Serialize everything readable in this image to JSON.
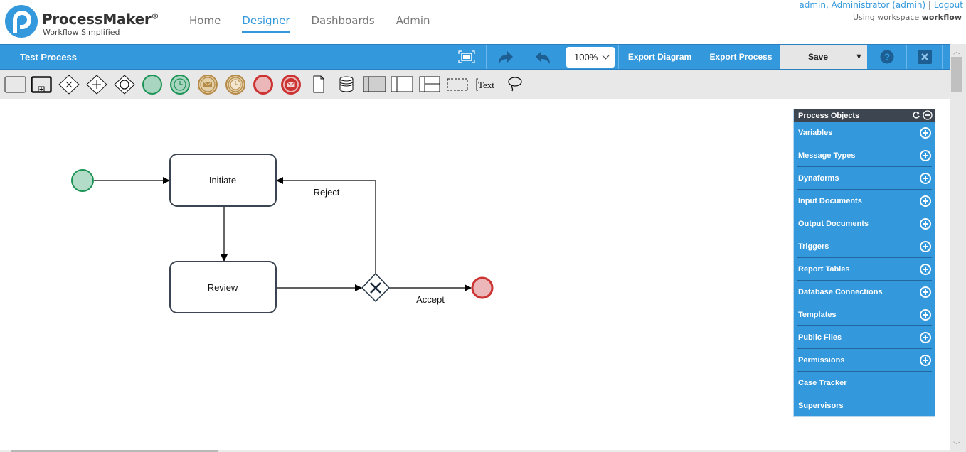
{
  "header": {
    "brand": "ProcessMaker",
    "brand_mark": "®",
    "tagline": "Workflow Simplified",
    "nav": [
      {
        "label": "Home",
        "active": false
      },
      {
        "label": "Designer",
        "active": true
      },
      {
        "label": "Dashboards",
        "active": false
      },
      {
        "label": "Admin",
        "active": false
      }
    ],
    "user": "admin, Administrator (admin)",
    "separator": "|",
    "logout": "Logout",
    "workspace_prefix": "Using workspace",
    "workspace": "workflow"
  },
  "toolbar": {
    "process_title": "Test Process",
    "fullscreen_icon": "fullscreen-icon",
    "redo_icon": "redo-icon",
    "undo_icon": "undo-icon",
    "zoom_value": "100%",
    "export_diagram": "Export Diagram",
    "export_process": "Export Process",
    "save": "Save",
    "help_icon": "help-icon",
    "close_icon": "close-icon"
  },
  "palette": {
    "tools": [
      {
        "name": "task",
        "icon": "task-icon"
      },
      {
        "name": "sub-process",
        "icon": "subprocess-icon"
      },
      {
        "name": "exclusive-gateway",
        "icon": "exclusive-gateway-icon"
      },
      {
        "name": "parallel-gateway",
        "icon": "parallel-gateway-icon"
      },
      {
        "name": "inclusive-gateway",
        "icon": "inclusive-gateway-icon"
      },
      {
        "name": "start-event",
        "icon": "start-event-icon"
      },
      {
        "name": "start-timer-event",
        "icon": "start-timer-event-icon"
      },
      {
        "name": "intermediate-message-event",
        "icon": "intermediate-message-event-icon"
      },
      {
        "name": "intermediate-timer-event",
        "icon": "intermediate-timer-event-icon"
      },
      {
        "name": "end-event",
        "icon": "end-event-icon"
      },
      {
        "name": "end-message-event",
        "icon": "end-message-event-icon"
      },
      {
        "name": "data-object",
        "icon": "data-object-icon"
      },
      {
        "name": "data-store",
        "icon": "data-store-icon"
      },
      {
        "name": "black-box-pool",
        "icon": "black-box-pool-icon"
      },
      {
        "name": "pool",
        "icon": "pool-icon"
      },
      {
        "name": "lane",
        "icon": "lane-icon"
      },
      {
        "name": "group",
        "icon": "group-icon"
      },
      {
        "name": "text-annotation",
        "icon": "text-annotation-icon",
        "label": "Text"
      },
      {
        "name": "lasso",
        "icon": "lasso-icon"
      }
    ]
  },
  "diagram": {
    "tasks": [
      {
        "label": "Initiate"
      },
      {
        "label": "Review"
      }
    ],
    "flows": [
      {
        "label": "Reject"
      },
      {
        "label": "Accept"
      }
    ],
    "colors": {
      "start_fill": "#b3dcc8",
      "start_stroke": "#1e9356",
      "end_fill": "#ebb7b9",
      "end_stroke": "#cc3333",
      "task_stroke": "#3b4450"
    }
  },
  "process_objects": {
    "title": "Process Objects",
    "items": [
      {
        "label": "Variables",
        "addable": true
      },
      {
        "label": "Message Types",
        "addable": true
      },
      {
        "label": "Dynaforms",
        "addable": true
      },
      {
        "label": "Input Documents",
        "addable": true
      },
      {
        "label": "Output Documents",
        "addable": true
      },
      {
        "label": "Triggers",
        "addable": true
      },
      {
        "label": "Report Tables",
        "addable": true
      },
      {
        "label": "Database Connections",
        "addable": true
      },
      {
        "label": "Templates",
        "addable": true
      },
      {
        "label": "Public Files",
        "addable": true
      },
      {
        "label": "Permissions",
        "addable": true
      },
      {
        "label": "Case Tracker",
        "addable": false
      },
      {
        "label": "Supervisors",
        "addable": false
      }
    ]
  },
  "colors": {
    "accent": "#3398dc",
    "panel_header": "#3d4550"
  }
}
